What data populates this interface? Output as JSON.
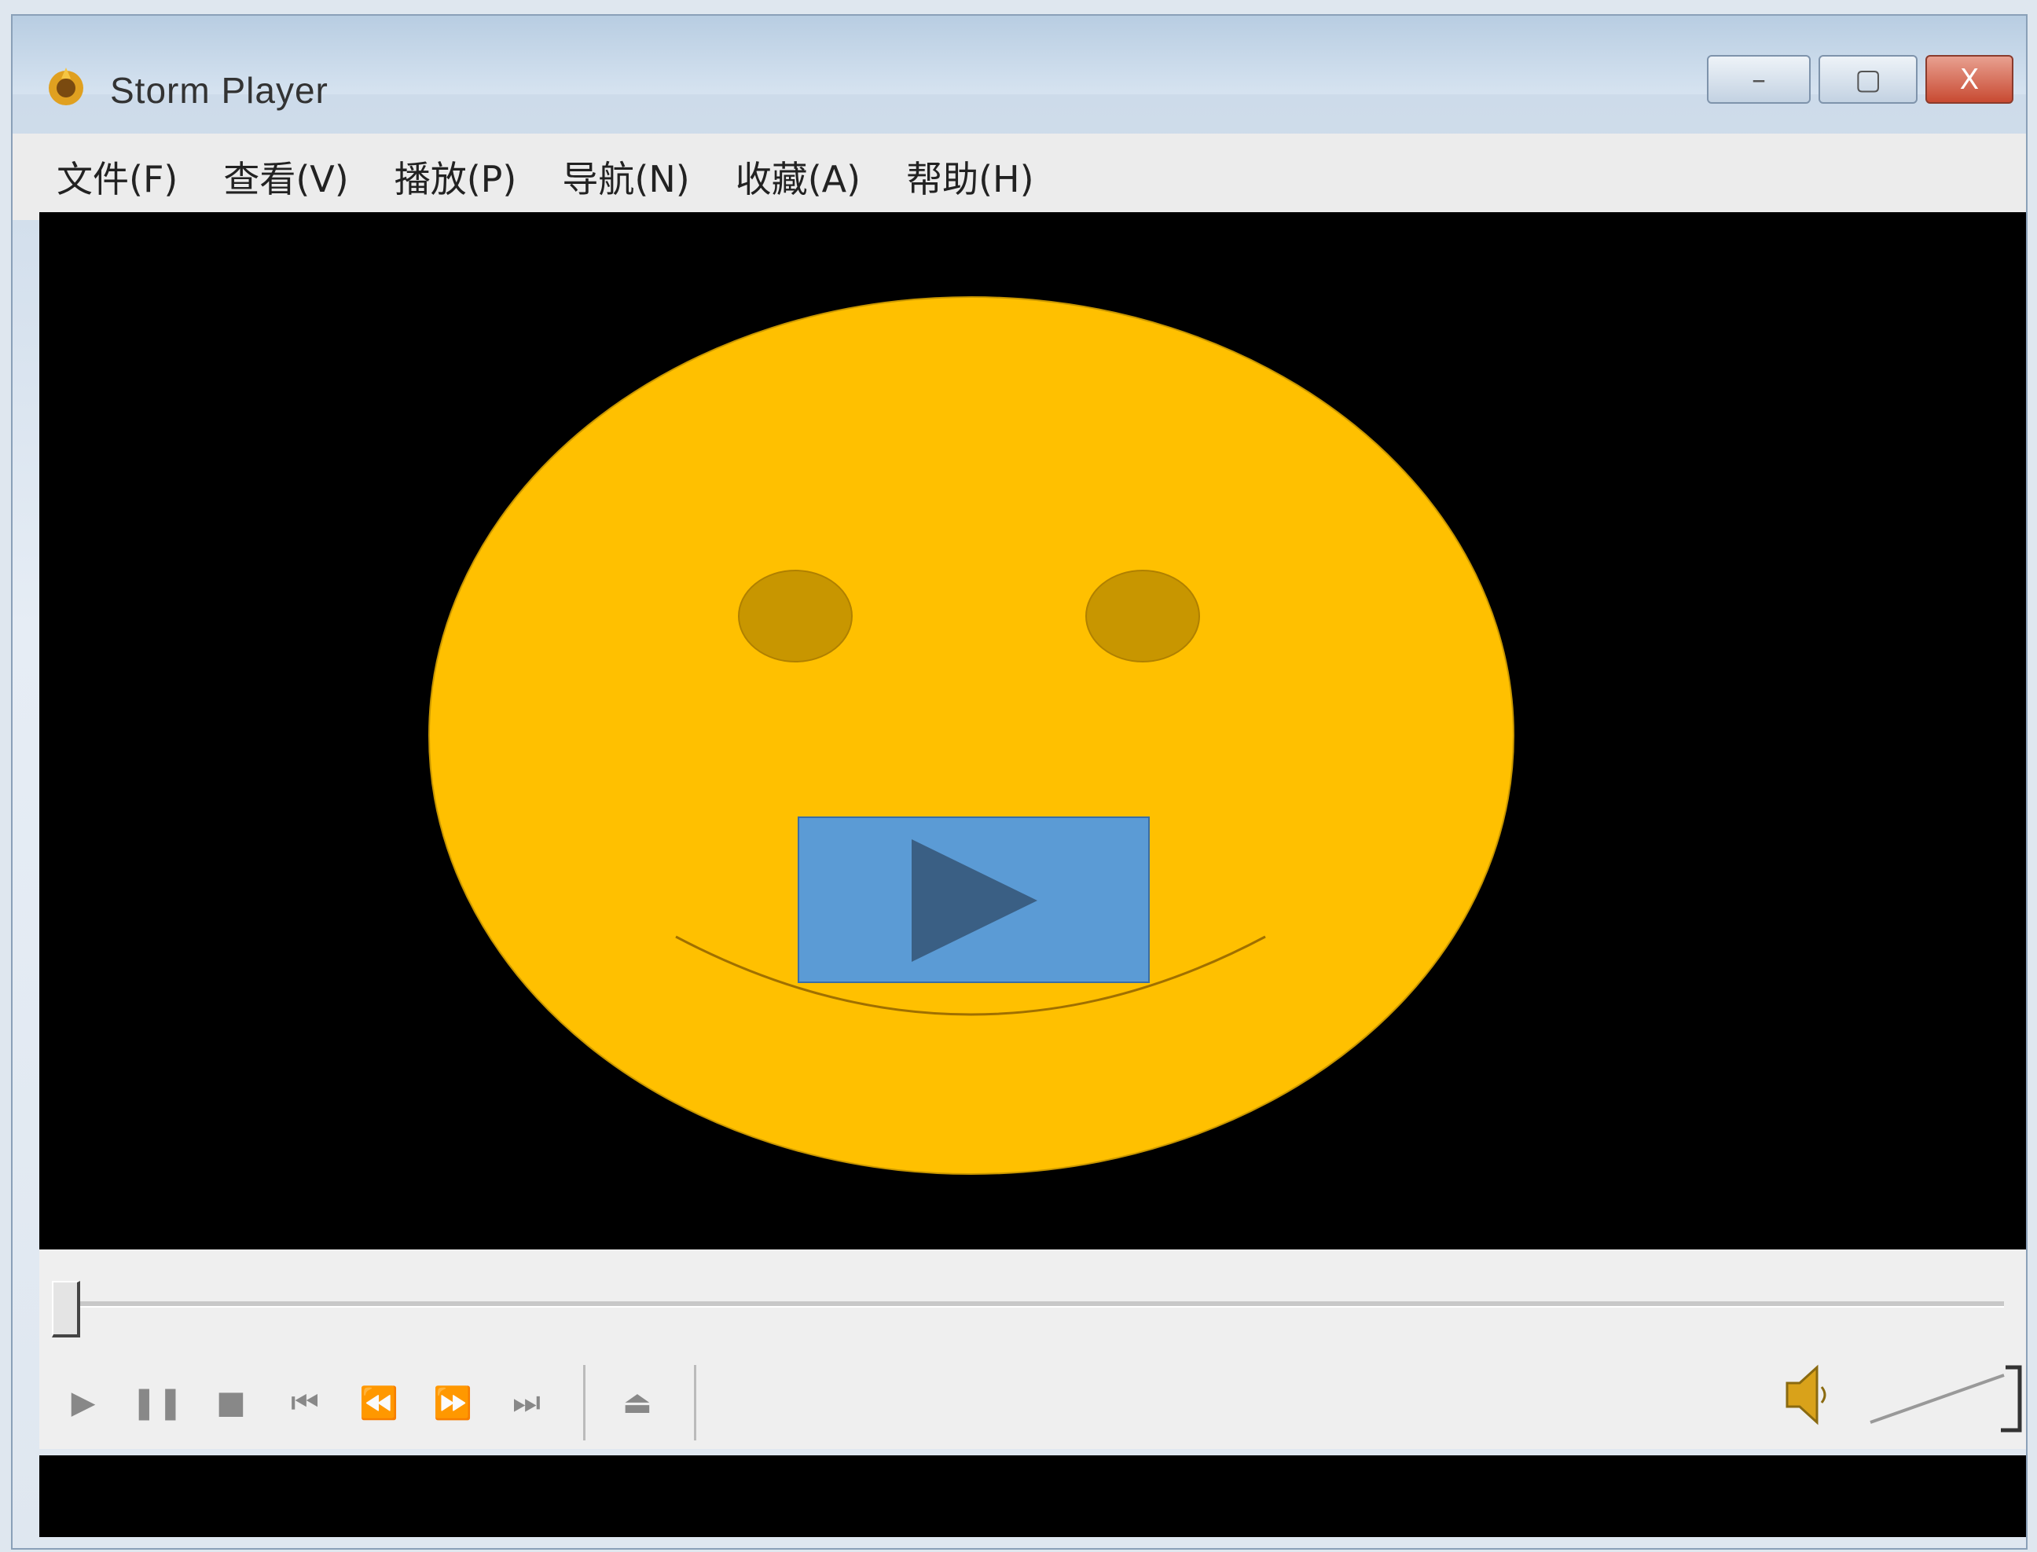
{
  "window": {
    "title": "Storm Player",
    "minimize_label": "–",
    "maximize_label": "▢",
    "close_label": "X"
  },
  "menu": {
    "items": [
      {
        "label": "文件(F)"
      },
      {
        "label": "查看(V)"
      },
      {
        "label": "播放(P)"
      },
      {
        "label": "导航(N)"
      },
      {
        "label": "收藏(A)"
      },
      {
        "label": "帮助(H)"
      }
    ]
  },
  "video": {
    "face_color": "#FFC000",
    "eye_color": "#C89600",
    "play_button_color": "#5B9BD5",
    "play_icon_color": "#3A5F84"
  },
  "controls": {
    "seek_position": 0,
    "buttons": [
      {
        "name": "play-icon",
        "glyph": "▶"
      },
      {
        "name": "pause-icon",
        "glyph": "❚❚"
      },
      {
        "name": "stop-icon",
        "glyph": "■"
      },
      {
        "name": "previous-icon",
        "glyph": "⏮"
      },
      {
        "name": "rewind-icon",
        "glyph": "⏪"
      },
      {
        "name": "fast-forward-icon",
        "glyph": "⏩"
      },
      {
        "name": "next-icon",
        "glyph": "⏭"
      },
      {
        "name": "open-file-icon",
        "glyph": "⏏"
      }
    ]
  }
}
